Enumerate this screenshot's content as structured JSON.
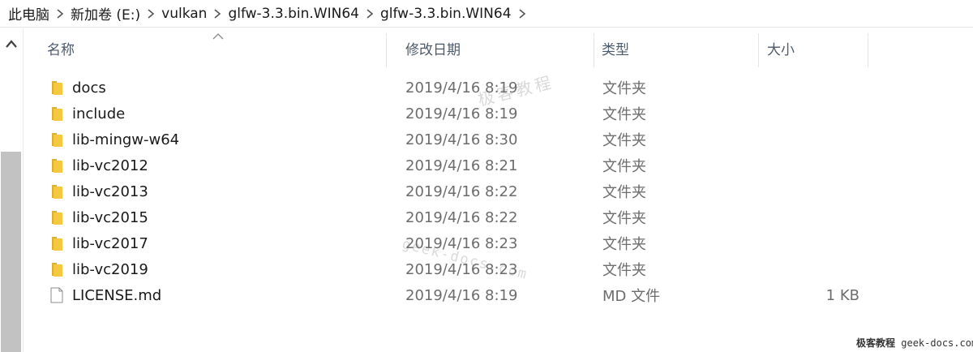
{
  "breadcrumb": {
    "items": [
      "此电脑",
      "新加卷 (E:)",
      "vulkan",
      "glfw-3.3.bin.WIN64",
      "glfw-3.3.bin.WIN64"
    ]
  },
  "columns": {
    "name": "名称",
    "date": "修改日期",
    "type": "类型",
    "size": "大小"
  },
  "files": [
    {
      "name": "docs",
      "date": "2019/4/16 8:19",
      "type": "文件夹",
      "size": "",
      "kind": "folder"
    },
    {
      "name": "include",
      "date": "2019/4/16 8:19",
      "type": "文件夹",
      "size": "",
      "kind": "folder"
    },
    {
      "name": "lib-mingw-w64",
      "date": "2019/4/16 8:30",
      "type": "文件夹",
      "size": "",
      "kind": "folder"
    },
    {
      "name": "lib-vc2012",
      "date": "2019/4/16 8:21",
      "type": "文件夹",
      "size": "",
      "kind": "folder"
    },
    {
      "name": "lib-vc2013",
      "date": "2019/4/16 8:22",
      "type": "文件夹",
      "size": "",
      "kind": "folder"
    },
    {
      "name": "lib-vc2015",
      "date": "2019/4/16 8:22",
      "type": "文件夹",
      "size": "",
      "kind": "folder"
    },
    {
      "name": "lib-vc2017",
      "date": "2019/4/16 8:23",
      "type": "文件夹",
      "size": "",
      "kind": "folder"
    },
    {
      "name": "lib-vc2019",
      "date": "2019/4/16 8:23",
      "type": "文件夹",
      "size": "",
      "kind": "folder"
    },
    {
      "name": "LICENSE.md",
      "date": "2019/4/16 8:19",
      "type": "MD 文件",
      "size": "1 KB",
      "kind": "file"
    }
  ],
  "watermark": {
    "text1": "极客教程",
    "text2": "geek-docs.com",
    "footer_cn": "极客教程",
    "footer_url": "geek-docs.com"
  },
  "colors": {
    "folder": "#F5C842",
    "folder_dark": "#E3AE27",
    "header_text": "#4D5A6B",
    "scroll_thumb": "#C2C2C2"
  },
  "icons": {
    "folder": "folder-icon",
    "file": "file-icon",
    "separator": "chevron-right-icon",
    "sort": "sort-ascending-icon",
    "scroll_up": "chevron-up-icon"
  }
}
